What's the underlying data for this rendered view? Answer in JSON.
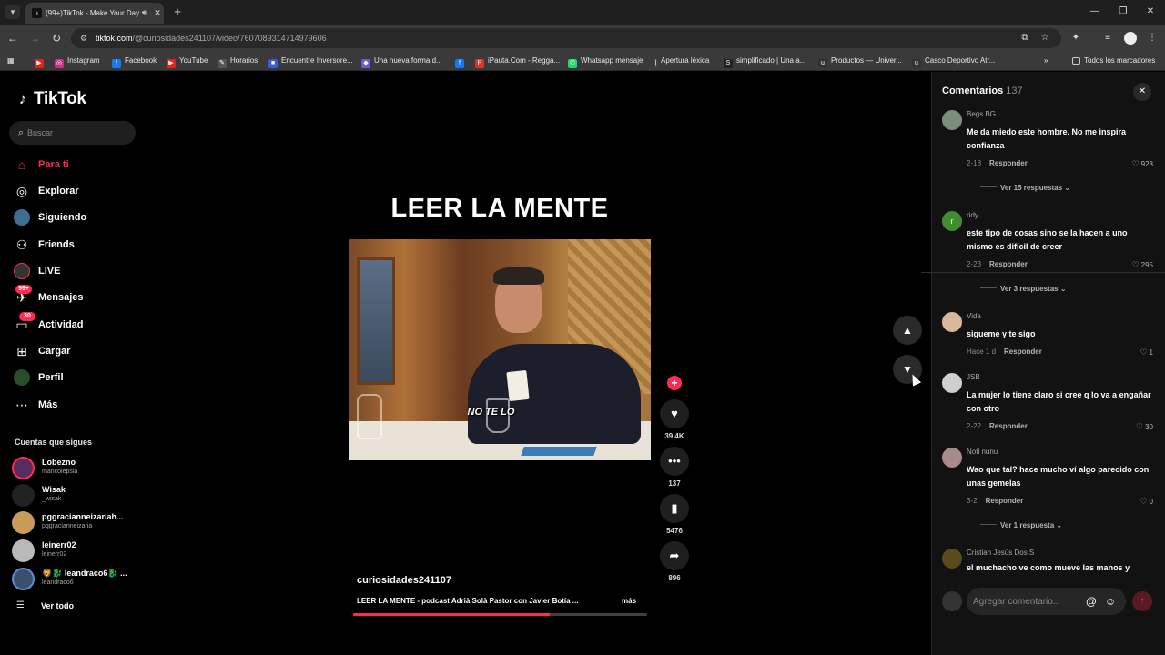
{
  "browser": {
    "tab_title": "(99+)TikTok - Make Your Day",
    "url_domain": "tiktok.com",
    "url_path": "/@curiosidades241107/video/7607089314714979606",
    "bookmarks": [
      "Instagram",
      "Facebook",
      "YouTube",
      "Horarios",
      "Encuentre Inversore...",
      "Una nueva forma d...",
      "iPauta.Com - Regga...",
      "Whatsapp mensaje",
      "Apertura léxica",
      "simplificado | Una a...",
      "Productos — Univer...",
      "Casco Deportivo Atr..."
    ],
    "all_bookmarks": "Todos los marcadores",
    "colors": {
      "chrome_bg": "#3a3a3a",
      "tab_bar": "#1f1f1f"
    }
  },
  "sidebar": {
    "logo_text": "TikTok",
    "search_placeholder": "Buscar",
    "nav": [
      {
        "label": "Para ti",
        "icon": "home-icon"
      },
      {
        "label": "Explorar",
        "icon": "compass-icon"
      },
      {
        "label": "Siguiendo",
        "icon": "following-avatar-icon"
      },
      {
        "label": "Friends",
        "icon": "friends-icon"
      },
      {
        "label": "LIVE",
        "icon": "live-icon"
      },
      {
        "label": "Mensajes",
        "icon": "messages-icon",
        "badge": "99+"
      },
      {
        "label": "Actividad",
        "icon": "activity-icon",
        "badge": "30"
      },
      {
        "label": "Cargar",
        "icon": "upload-icon"
      },
      {
        "label": "Perfil",
        "icon": "profile-icon"
      },
      {
        "label": "Más",
        "icon": "more-icon"
      }
    ],
    "following_title": "Cuentas que sigues",
    "accounts": [
      {
        "name": "Lobezno",
        "handle": "mancolepsia"
      },
      {
        "name": "Wisak",
        "handle": "_wisak"
      },
      {
        "name": "pggracianneizariah...",
        "handle": "pggracianneizaria"
      },
      {
        "name": "leinerr02",
        "handle": "leinerr02"
      },
      {
        "name": "🦁🐉 leandraco6🐉 ...",
        "handle": "leandraco6"
      }
    ],
    "see_all": "Ver todo",
    "accent_color": "#fe2c55"
  },
  "video": {
    "heading": "LEER LA MENTE",
    "caption": "NO TE LO",
    "author": "curiosidades241107",
    "description": "LEER LA MENTE - podcast Adrià Solà Pastor con Javier Botía ...",
    "more": "más",
    "progress": 0.67,
    "actions": {
      "likes": "39.4K",
      "comments": "137",
      "saves": "5476",
      "shares": "896"
    }
  },
  "comments": {
    "title": "Comentarios",
    "count": "137",
    "input_placeholder": "Agregar comentario...",
    "items": [
      {
        "user": "Begs BG",
        "text": "Me da miedo este hombre. No me inspira confianza",
        "date": "2-18",
        "reply": "Responder",
        "likes": "928",
        "more": "Ver 15 respuestas"
      },
      {
        "user": "ridy",
        "avatar_letter": "r",
        "text": "este tipo de cosas sino se la hacen a uno mismo es difícil de creer",
        "date": "2-23",
        "reply": "Responder",
        "likes": "295",
        "more": "Ver 3 respuestas"
      },
      {
        "user": "Vida",
        "text": "sigueme y te sigo",
        "date": "Hace 1 d",
        "reply": "Responder",
        "likes": "1"
      },
      {
        "user": "JSB",
        "text": "La mujer lo tiene claro si cree q lo va a engañar con otro",
        "date": "2-22",
        "reply": "Responder",
        "likes": "30"
      },
      {
        "user": "Noti nunu",
        "text": "Wao que tal? hace mucho ví algo parecido con unas gemelas",
        "date": "3-2",
        "reply": "Responder",
        "likes": "0",
        "more": "Ver 1 respuesta"
      },
      {
        "user": "Cristian Jesús Dos S",
        "text": "el muchacho ve como mueve las manos y"
      }
    ]
  }
}
